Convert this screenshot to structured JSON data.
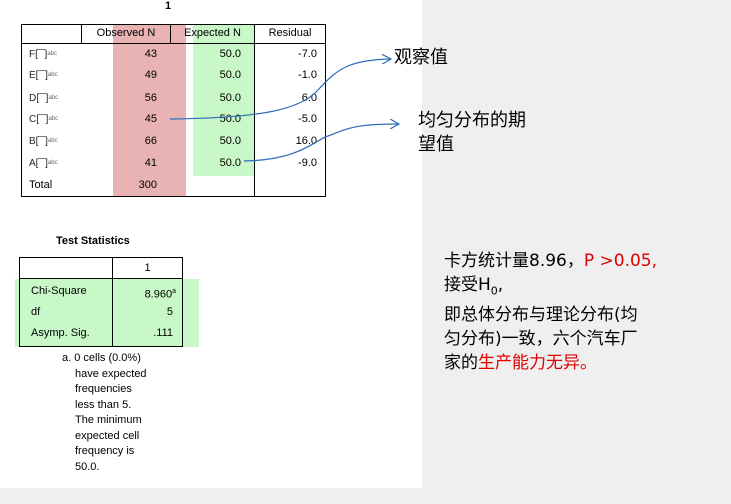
{
  "table_title": "1",
  "freq_table": {
    "headers": [
      "",
      "Observed N",
      "Expected N",
      "Residual"
    ],
    "rows": [
      {
        "label": "F",
        "observed": "43",
        "expected": "50.0",
        "residual": "-7.0"
      },
      {
        "label": "E",
        "observed": "49",
        "expected": "50.0",
        "residual": "-1.0"
      },
      {
        "label": "D",
        "observed": "56",
        "expected": "50.0",
        "residual": "6.0"
      },
      {
        "label": "C",
        "observed": "45",
        "expected": "50.0",
        "residual": "-5.0"
      },
      {
        "label": "B",
        "observed": "66",
        "expected": "50.0",
        "residual": "16.0"
      },
      {
        "label": "A",
        "observed": "41",
        "expected": "50.0",
        "residual": "-9.0"
      }
    ],
    "total": {
      "label": "Total",
      "observed": "300"
    }
  },
  "test_stats": {
    "title": "Test Statistics",
    "col_header": "1",
    "rows": [
      {
        "label": "Chi-Square",
        "value": "8.960",
        "sup": "a"
      },
      {
        "label": "df",
        "value": "5",
        "sup": ""
      },
      {
        "label": "Asymp. Sig.",
        "value": ".111",
        "sup": ""
      }
    ],
    "footnote_lines": [
      "a. 0 cells (0.0%)",
      "have expected",
      "frequencies",
      "less than 5.",
      "The minimum",
      "expected cell",
      "frequency is",
      "50.0."
    ]
  },
  "annotations": {
    "observed": "观察值",
    "expected_line1": "均匀分布的期",
    "expected_line2": "望值"
  },
  "conclusion": {
    "part1": "卡方统计量8.96，",
    "part1_red": "P >0.05,",
    "line2": "接受H",
    "line2_sub": "0",
    "line2_end": ",",
    "line3": "即总体分布与理论分布(均",
    "line4": "匀分布)一致，六个汽车厂",
    "line5": "家的",
    "line5_red": "生产能力无异。"
  },
  "colors": {
    "observed_highlight": "#e9b3b3",
    "expected_highlight": "#c8f7c8",
    "arrow": "#2a6ebb",
    "emphasis": "#e00000",
    "side_panel": "#efefef"
  }
}
